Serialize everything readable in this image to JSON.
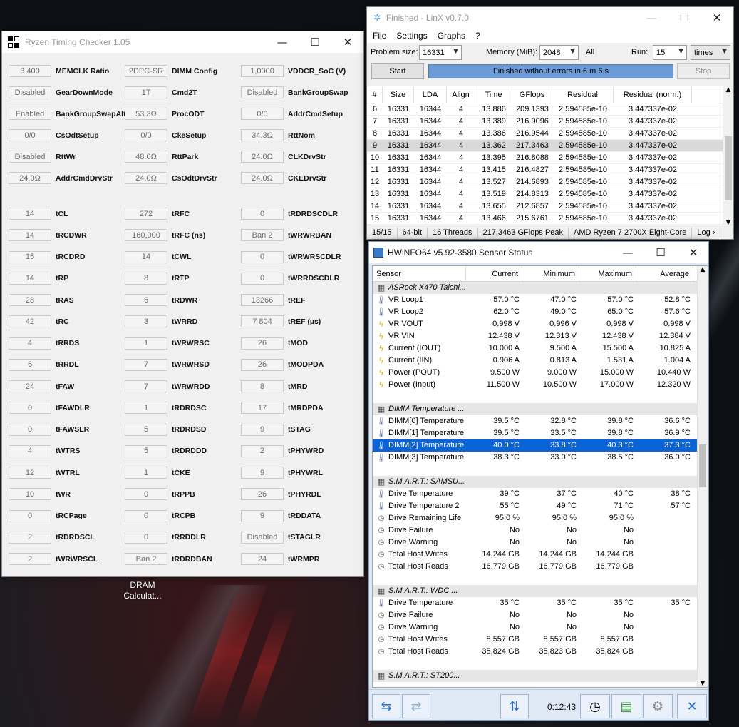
{
  "desktop": {
    "icon_label": "DRAM Calculat..."
  },
  "rtc": {
    "title": "Ryzen Timing Checker 1.05",
    "fields": [
      {
        "value": "3 400",
        "label": "MEMCLK Ratio"
      },
      {
        "value": "2DPC-SR",
        "label": "DIMM Config"
      },
      {
        "value": "1,0000",
        "label": "VDDCR_SoC (V)"
      },
      {
        "value": "Disabled",
        "label": "GearDownMode"
      },
      {
        "value": "1T",
        "label": "Cmd2T"
      },
      {
        "value": "Disabled",
        "label": "BankGroupSwap"
      },
      {
        "value": "Enabled",
        "label": "BankGroupSwapAlt"
      },
      {
        "value": "53.3Ω",
        "label": "ProcODT"
      },
      {
        "value": "0/0",
        "label": "AddrCmdSetup"
      },
      {
        "value": "0/0",
        "label": "CsOdtSetup"
      },
      {
        "value": "0/0",
        "label": "CkeSetup"
      },
      {
        "value": "34.3Ω",
        "label": "RttNom"
      },
      {
        "value": "Disabled",
        "label": "RttWr"
      },
      {
        "value": "48.0Ω",
        "label": "RttPark"
      },
      {
        "value": "24.0Ω",
        "label": "CLKDrvStr"
      },
      {
        "value": "24.0Ω",
        "label": "AddrCmdDrvStr"
      },
      {
        "value": "24.0Ω",
        "label": "CsOdtDrvStr"
      },
      {
        "value": "24.0Ω",
        "label": "CKEDrvStr"
      }
    ],
    "timings": [
      {
        "value": "14",
        "label": "tCL"
      },
      {
        "value": "272",
        "label": "tRFC"
      },
      {
        "value": "0",
        "label": "tRDRDSCDLR"
      },
      {
        "value": "14",
        "label": "tRCDWR"
      },
      {
        "value": "160,000",
        "label": "tRFC (ns)"
      },
      {
        "value": "Ban 2",
        "label": "tWRWRBAN"
      },
      {
        "value": "15",
        "label": "tRCDRD"
      },
      {
        "value": "14",
        "label": "tCWL"
      },
      {
        "value": "0",
        "label": "tWRWRSCDLR"
      },
      {
        "value": "14",
        "label": "tRP"
      },
      {
        "value": "8",
        "label": "tRTP"
      },
      {
        "value": "0",
        "label": "tWRRDSCDLR"
      },
      {
        "value": "28",
        "label": "tRAS"
      },
      {
        "value": "6",
        "label": "tRDWR"
      },
      {
        "value": "13266",
        "label": "tREF"
      },
      {
        "value": "42",
        "label": "tRC"
      },
      {
        "value": "3",
        "label": "tWRRD"
      },
      {
        "value": "7 804",
        "label": "tREF (µs)"
      },
      {
        "value": "4",
        "label": "tRRDS"
      },
      {
        "value": "1",
        "label": "tWRWRSC"
      },
      {
        "value": "26",
        "label": "tMOD"
      },
      {
        "value": "6",
        "label": "tRRDL"
      },
      {
        "value": "7",
        "label": "tWRWRSD"
      },
      {
        "value": "26",
        "label": "tMODPDA"
      },
      {
        "value": "24",
        "label": "tFAW"
      },
      {
        "value": "7",
        "label": "tWRWRDD"
      },
      {
        "value": "8",
        "label": "tMRD"
      },
      {
        "value": "0",
        "label": "tFAWDLR"
      },
      {
        "value": "1",
        "label": "tRDRDSC"
      },
      {
        "value": "17",
        "label": "tMRDPDA"
      },
      {
        "value": "0",
        "label": "tFAWSLR"
      },
      {
        "value": "5",
        "label": "tRDRDSD"
      },
      {
        "value": "9",
        "label": "tSTAG"
      },
      {
        "value": "4",
        "label": "tWTRS"
      },
      {
        "value": "5",
        "label": "tRDRDDD"
      },
      {
        "value": "2",
        "label": "tPHYWRD"
      },
      {
        "value": "12",
        "label": "tWTRL"
      },
      {
        "value": "1",
        "label": "tCKE"
      },
      {
        "value": "9",
        "label": "tPHYWRL"
      },
      {
        "value": "10",
        "label": "tWR"
      },
      {
        "value": "0",
        "label": "tRPPB"
      },
      {
        "value": "26",
        "label": "tPHYRDL"
      },
      {
        "value": "0",
        "label": "tRCPage"
      },
      {
        "value": "0",
        "label": "tRCPB"
      },
      {
        "value": "9",
        "label": "tRDDATA"
      },
      {
        "value": "2",
        "label": "tRDRDSCL"
      },
      {
        "value": "0",
        "label": "tRRDDLR"
      },
      {
        "value": "Disabled",
        "label": "tSTAGLR"
      },
      {
        "value": "2",
        "label": "tWRWRSCL"
      },
      {
        "value": "Ban 2",
        "label": "tRDRDBAN"
      },
      {
        "value": "24",
        "label": "tWRMPR"
      }
    ]
  },
  "linx": {
    "title": "Finished - LinX v0.7.0",
    "menu": [
      "File",
      "Settings",
      "Graphs",
      "?"
    ],
    "problem_size_label": "Problem size:",
    "problem_size": "16331",
    "memory_label": "Memory (MiB):",
    "memory": "2048",
    "all_label": "All",
    "run_label": "Run:",
    "runs": "15",
    "runs_unit": "times",
    "start_label": "Start",
    "stop_label": "Stop",
    "progress_text": "Finished without errors in 6 m 6 s",
    "columns": [
      "#",
      "Size",
      "LDA",
      "Align",
      "Time",
      "GFlops",
      "Residual",
      "Residual (norm.)"
    ],
    "rows": [
      [
        "6",
        "16331",
        "16344",
        "4",
        "13.886",
        "209.1393",
        "2.594585e-10",
        "3.447337e-02"
      ],
      [
        "7",
        "16331",
        "16344",
        "4",
        "13.389",
        "216.9096",
        "2.594585e-10",
        "3.447337e-02"
      ],
      [
        "8",
        "16331",
        "16344",
        "4",
        "13.386",
        "216.9544",
        "2.594585e-10",
        "3.447337e-02"
      ],
      [
        "9",
        "16331",
        "16344",
        "4",
        "13.362",
        "217.3463",
        "2.594585e-10",
        "3.447337e-02"
      ],
      [
        "10",
        "16331",
        "16344",
        "4",
        "13.395",
        "216.8088",
        "2.594585e-10",
        "3.447337e-02"
      ],
      [
        "11",
        "16331",
        "16344",
        "4",
        "13.415",
        "216.4827",
        "2.594585e-10",
        "3.447337e-02"
      ],
      [
        "12",
        "16331",
        "16344",
        "4",
        "13.527",
        "214.6893",
        "2.594585e-10",
        "3.447337e-02"
      ],
      [
        "13",
        "16331",
        "16344",
        "4",
        "13.519",
        "214.8313",
        "2.594585e-10",
        "3.447337e-02"
      ],
      [
        "14",
        "16331",
        "16344",
        "4",
        "13.655",
        "212.6857",
        "2.594585e-10",
        "3.447337e-02"
      ],
      [
        "15",
        "16331",
        "16344",
        "4",
        "13.466",
        "215.6761",
        "2.594585e-10",
        "3.447337e-02"
      ]
    ],
    "selected_row": 3,
    "status": [
      "15/15",
      "64-bit",
      "16 Threads",
      "217.3463 GFlops Peak",
      "AMD Ryzen 7 2700X Eight-Core",
      "Log ›"
    ]
  },
  "hwinfo": {
    "title": "HWiNFO64 v5.92-3580 Sensor Status",
    "columns": [
      "Sensor",
      "Current",
      "Minimum",
      "Maximum",
      "Average"
    ],
    "rows": [
      {
        "type": "group",
        "icon": "chip-icon",
        "name": "ASRock X470 Taichi..."
      },
      {
        "type": "row",
        "icon": "thermometer-icon",
        "name": "VR Loop1",
        "cur": "57.0 °C",
        "min": "47.0 °C",
        "max": "57.0 °C",
        "avg": "52.8 °C"
      },
      {
        "type": "row",
        "icon": "thermometer-icon",
        "name": "VR Loop2",
        "cur": "62.0 °C",
        "min": "49.0 °C",
        "max": "65.0 °C",
        "avg": "57.6 °C"
      },
      {
        "type": "row",
        "icon": "bolt-icon",
        "name": "VR VOUT",
        "cur": "0.998 V",
        "min": "0.996 V",
        "max": "0.998 V",
        "avg": "0.998 V"
      },
      {
        "type": "row",
        "icon": "bolt-icon",
        "name": "VR VIN",
        "cur": "12.438 V",
        "min": "12.313 V",
        "max": "12.438 V",
        "avg": "12.384 V"
      },
      {
        "type": "row",
        "icon": "bolt-icon",
        "name": "Current (IOUT)",
        "cur": "10.000 A",
        "min": "9.500 A",
        "max": "15.500 A",
        "avg": "10.825 A"
      },
      {
        "type": "row",
        "icon": "bolt-icon",
        "name": "Current (IIN)",
        "cur": "0.906 A",
        "min": "0.813 A",
        "max": "1.531 A",
        "avg": "1.004 A"
      },
      {
        "type": "row",
        "icon": "bolt-icon",
        "name": "Power (POUT)",
        "cur": "9.500 W",
        "min": "9.000 W",
        "max": "15.000 W",
        "avg": "10.440 W"
      },
      {
        "type": "row",
        "icon": "bolt-icon",
        "name": "Power (Input)",
        "cur": "11.500 W",
        "min": "10.500 W",
        "max": "17.000 W",
        "avg": "12.320 W"
      },
      {
        "type": "blank"
      },
      {
        "type": "group",
        "icon": "chip-icon",
        "name": "DIMM Temperature ..."
      },
      {
        "type": "row",
        "icon": "thermometer-icon",
        "name": "DIMM[0] Temperature",
        "cur": "39.5 °C",
        "min": "32.8 °C",
        "max": "39.8 °C",
        "avg": "36.6 °C"
      },
      {
        "type": "row",
        "icon": "thermometer-icon",
        "name": "DIMM[1] Temperature",
        "cur": "39.5 °C",
        "min": "33.5 °C",
        "max": "39.8 °C",
        "avg": "36.9 °C"
      },
      {
        "type": "sel",
        "icon": "thermometer-icon",
        "name": "DIMM[2] Temperature",
        "cur": "40.0 °C",
        "min": "33.8 °C",
        "max": "40.3 °C",
        "avg": "37.3 °C"
      },
      {
        "type": "row",
        "icon": "thermometer-icon",
        "name": "DIMM[3] Temperature",
        "cur": "38.3 °C",
        "min": "33.0 °C",
        "max": "38.5 °C",
        "avg": "36.0 °C"
      },
      {
        "type": "blank"
      },
      {
        "type": "group",
        "icon": "disk-icon",
        "name": "S.M.A.R.T.: SAMSU..."
      },
      {
        "type": "row",
        "icon": "thermometer-icon",
        "name": "Drive Temperature",
        "cur": "39 °C",
        "min": "37 °C",
        "max": "40 °C",
        "avg": "38 °C"
      },
      {
        "type": "row",
        "icon": "thermometer-icon",
        "name": "Drive Temperature 2",
        "cur": "55 °C",
        "min": "49 °C",
        "max": "71 °C",
        "avg": "57 °C"
      },
      {
        "type": "row",
        "icon": "gauge-icon",
        "name": "Drive Remaining Life",
        "cur": "95.0 %",
        "min": "95.0 %",
        "max": "95.0 %",
        "avg": ""
      },
      {
        "type": "row",
        "icon": "gauge-icon",
        "name": "Drive Failure",
        "cur": "No",
        "min": "No",
        "max": "No",
        "avg": ""
      },
      {
        "type": "row",
        "icon": "gauge-icon",
        "name": "Drive Warning",
        "cur": "No",
        "min": "No",
        "max": "No",
        "avg": ""
      },
      {
        "type": "row",
        "icon": "gauge-icon",
        "name": "Total Host Writes",
        "cur": "14,244 GB",
        "min": "14,244 GB",
        "max": "14,244 GB",
        "avg": ""
      },
      {
        "type": "row",
        "icon": "gauge-icon",
        "name": "Total Host Reads",
        "cur": "16,779 GB",
        "min": "16,779 GB",
        "max": "16,779 GB",
        "avg": ""
      },
      {
        "type": "blank"
      },
      {
        "type": "group",
        "icon": "disk-icon",
        "name": "S.M.A.R.T.: WDC ..."
      },
      {
        "type": "row",
        "icon": "thermometer-icon",
        "name": "Drive Temperature",
        "cur": "35 °C",
        "min": "35 °C",
        "max": "35 °C",
        "avg": "35 °C"
      },
      {
        "type": "row",
        "icon": "gauge-icon",
        "name": "Drive Failure",
        "cur": "No",
        "min": "No",
        "max": "No",
        "avg": ""
      },
      {
        "type": "row",
        "icon": "gauge-icon",
        "name": "Drive Warning",
        "cur": "No",
        "min": "No",
        "max": "No",
        "avg": ""
      },
      {
        "type": "row",
        "icon": "gauge-icon",
        "name": "Total Host Writes",
        "cur": "8,557 GB",
        "min": "8,557 GB",
        "max": "8,557 GB",
        "avg": ""
      },
      {
        "type": "row",
        "icon": "gauge-icon",
        "name": "Total Host Reads",
        "cur": "35,824 GB",
        "min": "35,823 GB",
        "max": "35,824 GB",
        "avg": ""
      },
      {
        "type": "blank"
      },
      {
        "type": "group",
        "icon": "disk-icon",
        "name": "S.M.A.R.T.: ST200..."
      }
    ],
    "timer": "0:12:43"
  }
}
